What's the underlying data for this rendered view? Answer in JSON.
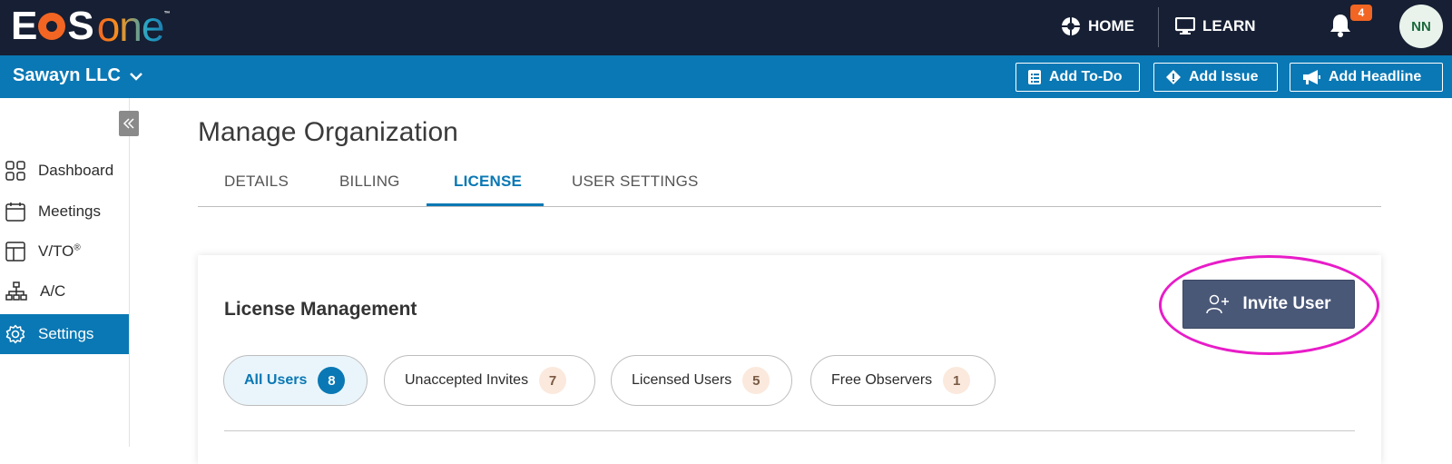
{
  "header": {
    "logo": {
      "brand_first": "E",
      "brand_second": "S",
      "brand_suffix": "one",
      "trademark": "™"
    },
    "nav": [
      {
        "label": "HOME",
        "icon": "globe-icon"
      },
      {
        "label": "LEARN",
        "icon": "monitor-icon"
      }
    ],
    "notifications": {
      "count": "4",
      "icon": "bell-icon"
    },
    "user_initials": "NN"
  },
  "org_bar": {
    "org_name": "Sawayn LLC",
    "actions": [
      {
        "label": "Add To-Do",
        "icon": "list-icon"
      },
      {
        "label": "Add Issue",
        "icon": "diamond-icon"
      },
      {
        "label": "Add Headline",
        "icon": "megaphone-icon"
      }
    ]
  },
  "sidebar": {
    "items": [
      {
        "label": "Dashboard",
        "icon": "grid-icon"
      },
      {
        "label": "Meetings",
        "icon": "calendar-icon"
      },
      {
        "label": "V/TO",
        "sup": "®",
        "icon": "layout-icon"
      },
      {
        "label": "A/C",
        "icon": "org-chart-icon"
      },
      {
        "label": "Settings",
        "icon": "gear-icon",
        "active": true
      }
    ]
  },
  "page": {
    "title": "Manage Organization",
    "tabs": [
      {
        "label": "DETAILS"
      },
      {
        "label": "BILLING"
      },
      {
        "label": "LICENSE",
        "active": true
      },
      {
        "label": "USER SETTINGS"
      }
    ]
  },
  "license": {
    "title": "License Management",
    "invite_button": "Invite User",
    "filters": [
      {
        "label": "All Users",
        "count": "8",
        "active": true
      },
      {
        "label": "Unaccepted Invites",
        "count": "7"
      },
      {
        "label": "Licensed Users",
        "count": "5"
      },
      {
        "label": "Free Observers",
        "count": "1"
      }
    ]
  },
  "colors": {
    "navbar": "#161f33",
    "org_bar": "#0a78b4",
    "accent": "#0a78b4",
    "invite_button": "#4a5878",
    "highlight_ring": "#e81cc8",
    "notification_badge": "#f26522"
  }
}
